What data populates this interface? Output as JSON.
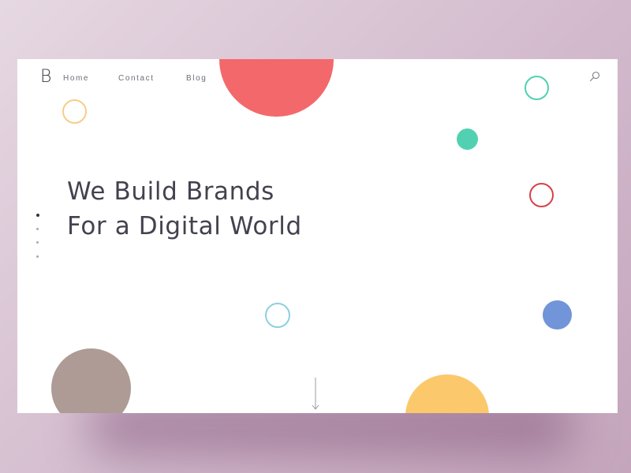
{
  "brand": {
    "logo_letter": "B"
  },
  "nav": {
    "items": [
      {
        "label": "Home"
      },
      {
        "label": "Contact"
      },
      {
        "label": "Blog"
      }
    ]
  },
  "search": {
    "icon": "search-icon"
  },
  "hero": {
    "headline_line1": "We Build Brands",
    "headline_line2": "For a Digital World"
  },
  "slider": {
    "total": 4,
    "active": 1
  },
  "decor": {
    "colors": {
      "coral": "#f3686b",
      "teal": "#52d1b2",
      "yellow_outline": "#f7cd88",
      "red_outline": "#d6424b",
      "light_blue_outline": "#8bd0de",
      "blue": "#7294d8",
      "taupe": "#ae9b95",
      "yellow": "#fbc86b"
    }
  },
  "scroll": {
    "icon": "arrow-down-icon"
  }
}
